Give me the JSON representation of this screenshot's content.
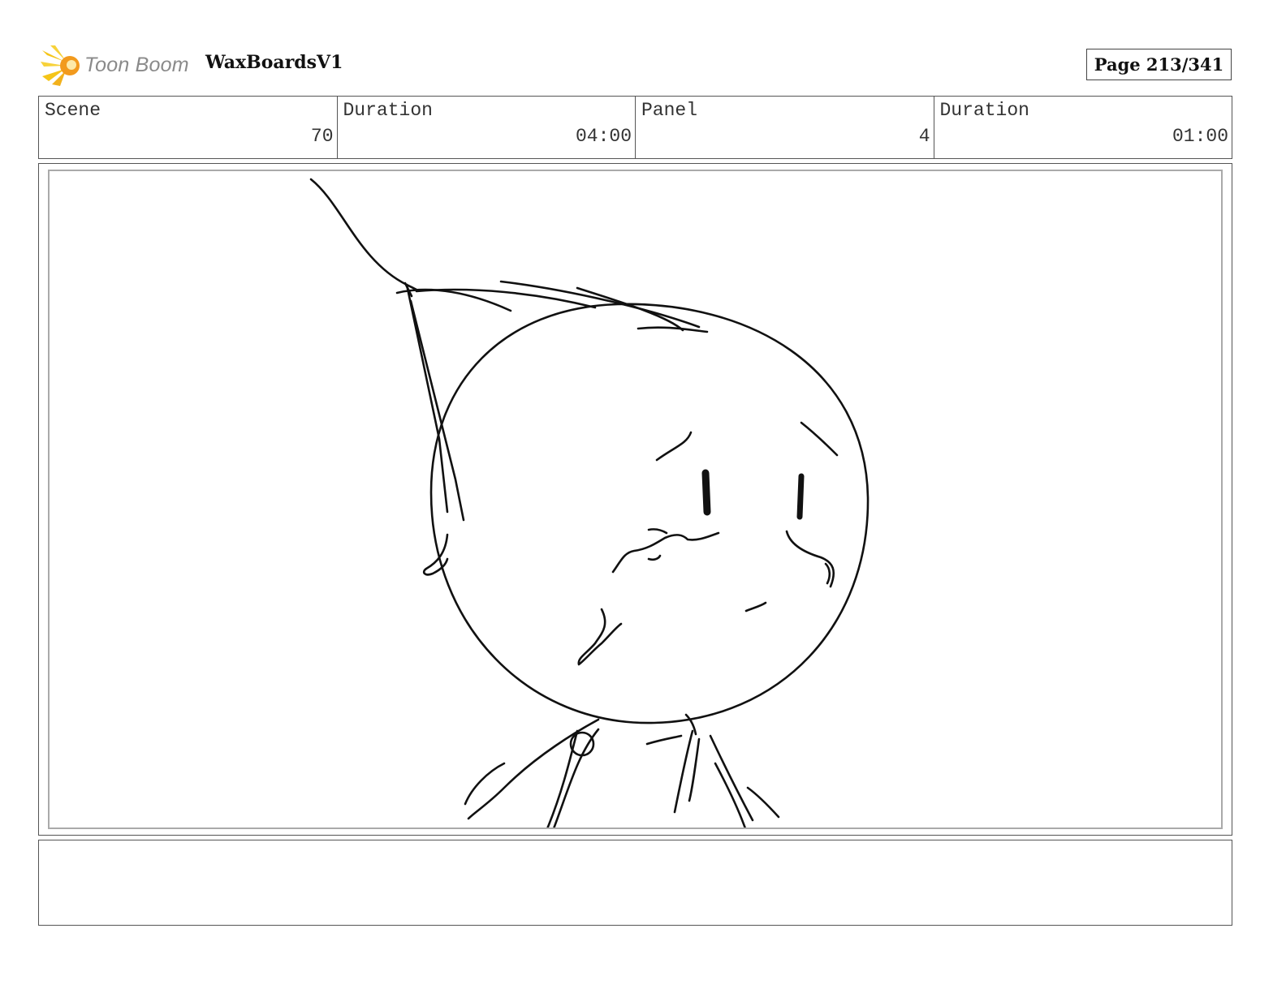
{
  "header": {
    "logo_text": "Toon Boom",
    "logo_icon": "starburst-logo-icon",
    "project_title": "WaxBoardsV1",
    "page_label": "Page 213/341"
  },
  "info": {
    "scene_label": "Scene",
    "scene_value": "70",
    "scene_duration_label": "Duration",
    "scene_duration_value": "04:00",
    "panel_label": "Panel",
    "panel_value": "4",
    "panel_duration_label": "Duration",
    "panel_duration_value": "01:00"
  },
  "colors": {
    "logo_yellow": "#f5c518",
    "logo_orange": "#f29a1d",
    "border": "#555555",
    "sketch_ink": "#111111"
  }
}
